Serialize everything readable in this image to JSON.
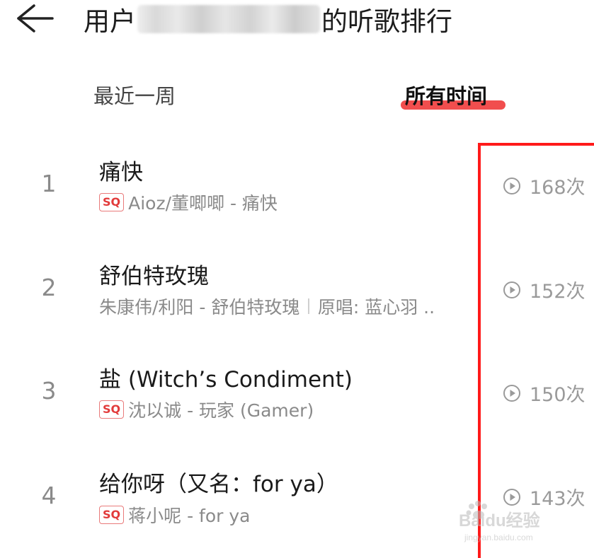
{
  "header": {
    "title_prefix": "用户",
    "title_suffix": "的听歌排行"
  },
  "tabs": [
    {
      "label": "最近一周",
      "active": false
    },
    {
      "label": "所有时间",
      "active": true
    }
  ],
  "songs": [
    {
      "rank": "1",
      "title": "痛快",
      "sq": true,
      "artist_album": "Aioz/董唧唧 - 痛快",
      "original_singer": "",
      "play_count": "168次"
    },
    {
      "rank": "2",
      "title": "舒伯特玫瑰",
      "sq": false,
      "artist_album": "朱康伟/利阳 - 舒伯特玫瑰",
      "original_singer": "原唱: 蓝心羽 ..",
      "play_count": "152次"
    },
    {
      "rank": "3",
      "title": "盐 (Witch’s Condiment)",
      "sq": true,
      "artist_album": "沈以诚 - 玩家 (Gamer)",
      "original_singer": "",
      "play_count": "150次"
    },
    {
      "rank": "4",
      "title": "给你呀（又名：for ya）",
      "sq": true,
      "artist_album": "蒋小呢 - for ya",
      "original_singer": "",
      "play_count": "143次"
    }
  ],
  "badge": {
    "sq_label": "SQ"
  },
  "watermark": {
    "text": "Baidu经验",
    "url_text": "jingyan.baidu.com"
  },
  "colors": {
    "accent": "#ef3b3b",
    "highlight_box": "#ff1a1a",
    "muted_text": "#8a8a8a"
  },
  "icons": {
    "back": "arrow-left-icon",
    "play": "play-circle-icon"
  }
}
